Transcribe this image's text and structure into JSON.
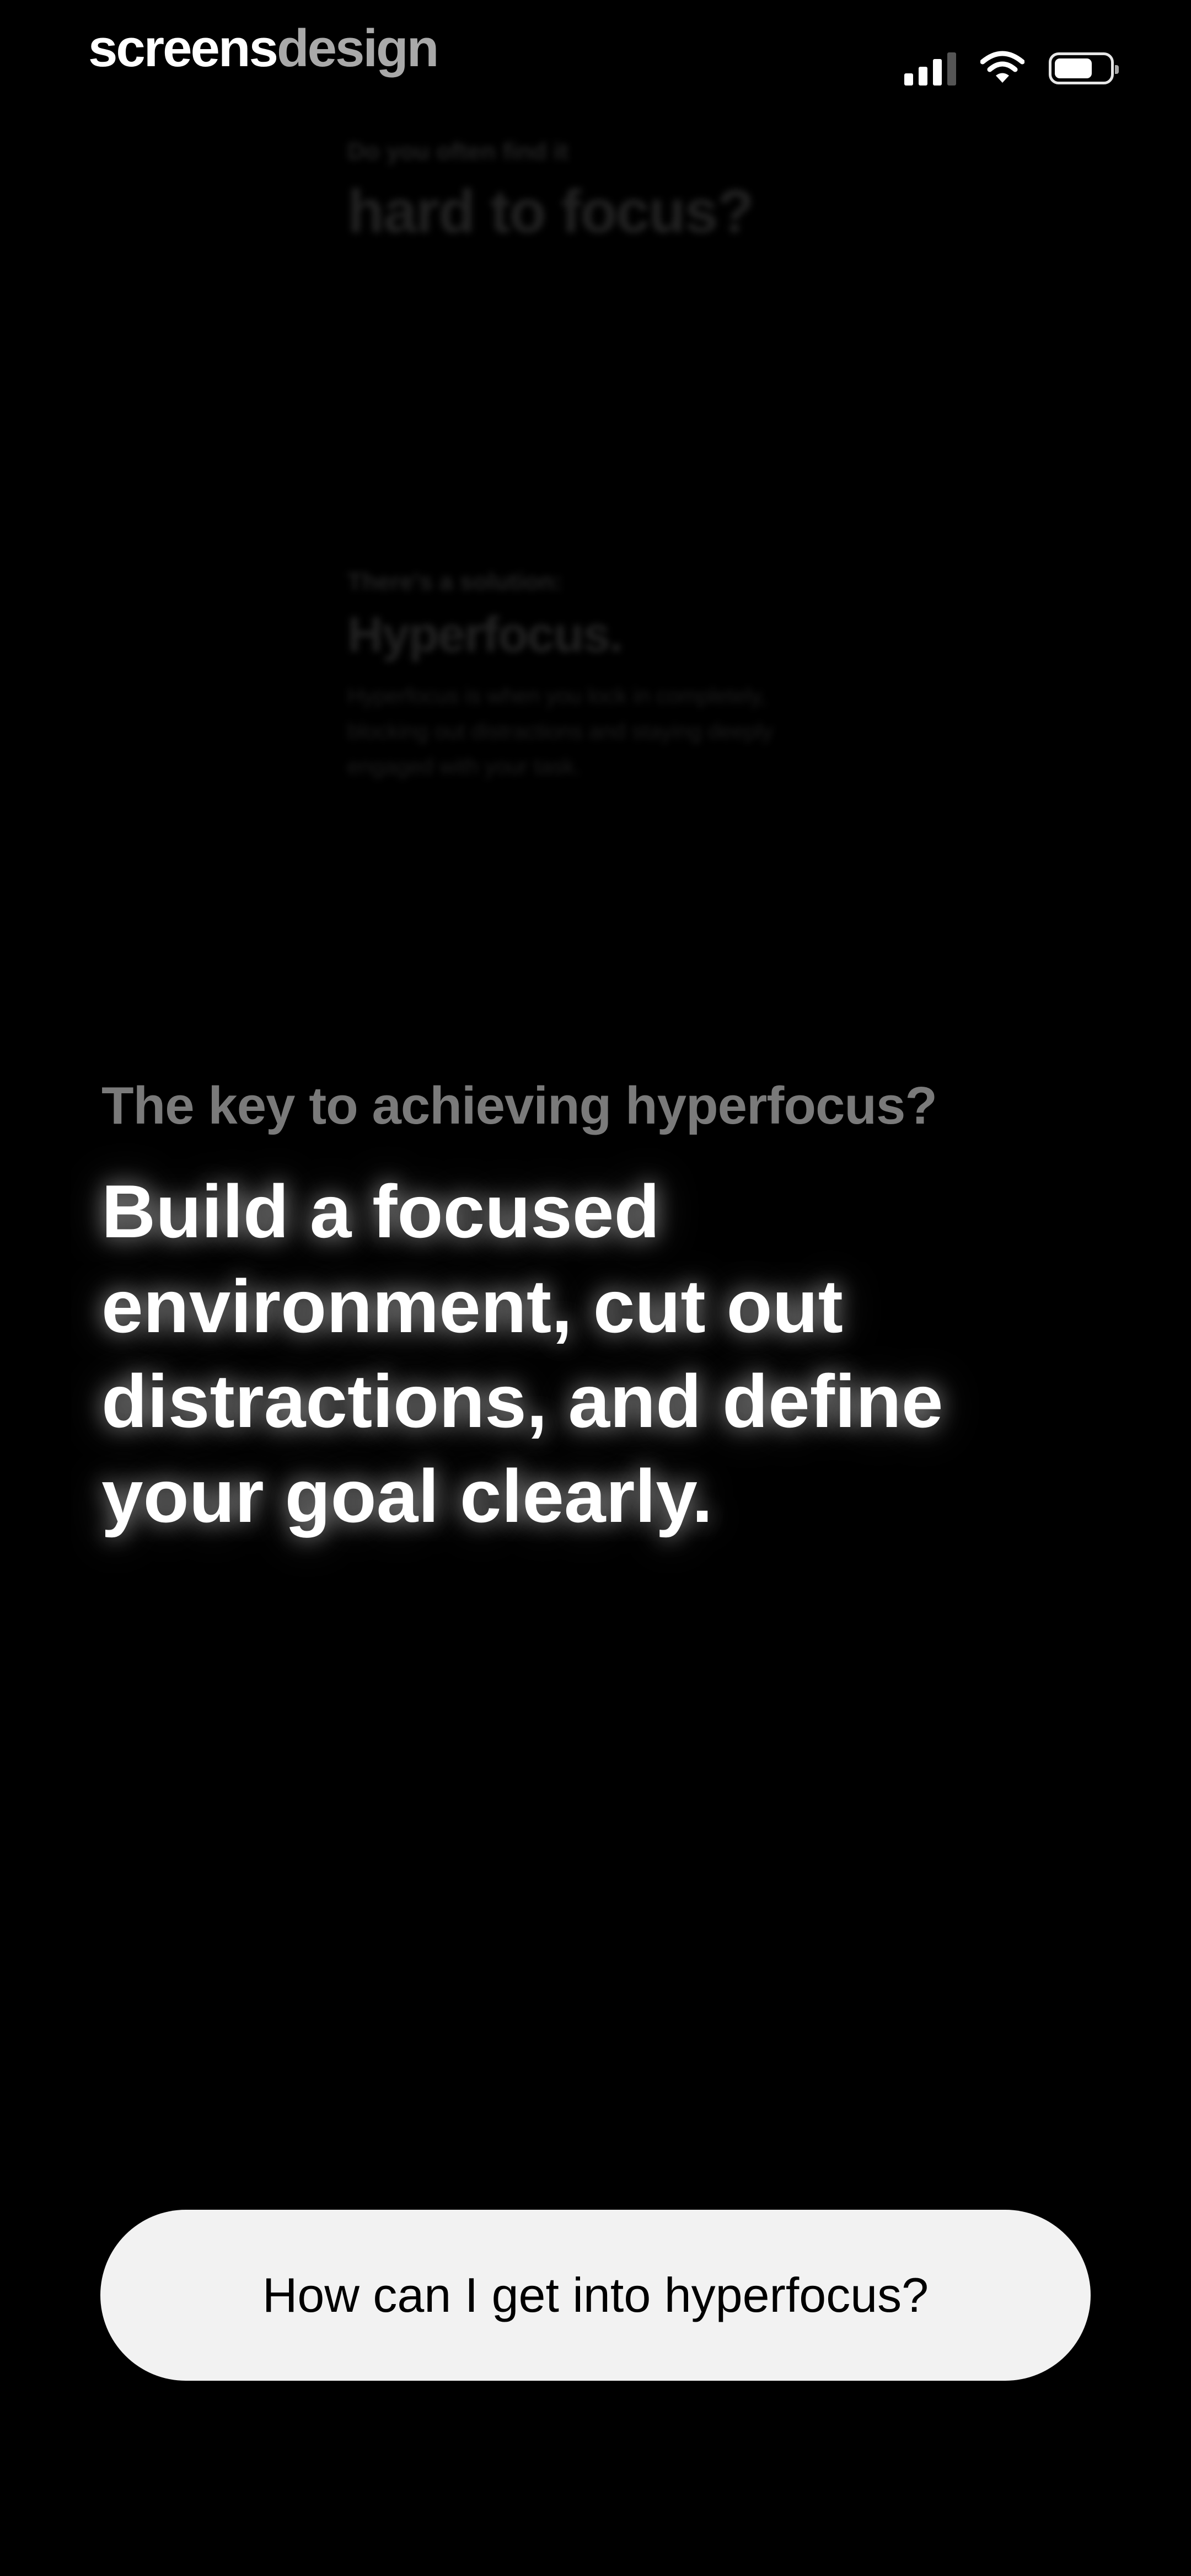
{
  "brand": {
    "part1": "screens",
    "part2": "design"
  },
  "status_bar": {
    "icons": [
      "cellular-signal-icon",
      "wifi-icon",
      "battery-icon"
    ],
    "battery_level": 0.7
  },
  "background": {
    "q_small": "Do you often find it",
    "q_large": "hard to focus?",
    "a_small": "There's a solution:",
    "a_large": "Hyperfocus.",
    "a_body": "Hyperfocus is when you lock in completely, blocking out distractions and staying deeply engaged with your task."
  },
  "content": {
    "intro": "The key to achieving hyperfocus?",
    "headline": "Build a focused environment, cut out distractions, and define your goal clearly."
  },
  "cta": {
    "label": "How can I get into hyperfocus?"
  },
  "colors": {
    "background": "#000000",
    "button": "#f2f2f2",
    "intro_text": "#7a7a7a"
  }
}
